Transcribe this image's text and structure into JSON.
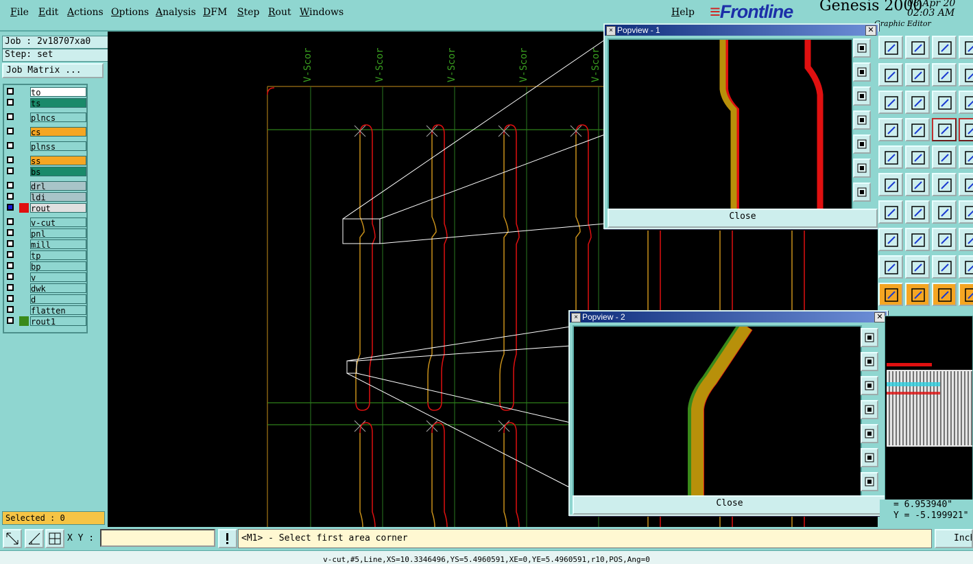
{
  "menu": {
    "items": [
      "File",
      "Edit",
      "Actions",
      "Options",
      "Analysis",
      "DFM",
      "Step",
      "Rout",
      "Windows"
    ],
    "help": "Help"
  },
  "brand": {
    "logo": "Frontline",
    "product": "Genesis 2000",
    "date": "08 Apr 20",
    "time": "02:03 AM",
    "subtitle": "Graphic Editor"
  },
  "job": {
    "job_label": "Job : 2v18707xa0",
    "step_label": "Step: set",
    "matrix_button": "Job Matrix ..."
  },
  "layers": [
    {
      "name": "to",
      "color": "#ffffff",
      "checked": false
    },
    {
      "name": "ts",
      "color": "#1a8a6a",
      "checked": false
    },
    {
      "name": "plncs",
      "color": "#8fd6d0",
      "checked": false
    },
    {
      "name": "cs",
      "color": "#f5a623",
      "checked": false
    },
    {
      "name": "plnss",
      "color": "#8fd6d0",
      "checked": false
    },
    {
      "name": "ss",
      "color": "#f5a623",
      "checked": false
    },
    {
      "name": "bs",
      "color": "#1a8a6a",
      "checked": false
    },
    {
      "name": "drl",
      "color": "#a8c4c8",
      "checked": false
    },
    {
      "name": "ldi",
      "color": "#a8c4c8",
      "checked": false
    },
    {
      "name": "rout",
      "color": "#e0e0e0",
      "checked": true,
      "swatch": "#e01010"
    },
    {
      "name": "v-cut",
      "color": "#8fd6d0",
      "checked": false
    },
    {
      "name": "pnl",
      "color": "#8fd6d0",
      "checked": false
    },
    {
      "name": "mill",
      "color": "#8fd6d0",
      "checked": false
    },
    {
      "name": "tp",
      "color": "#8fd6d0",
      "checked": false
    },
    {
      "name": "bp",
      "color": "#8fd6d0",
      "checked": false
    },
    {
      "name": "v",
      "color": "#8fd6d0",
      "checked": false
    },
    {
      "name": "dwk",
      "color": "#8fd6d0",
      "checked": false
    },
    {
      "name": "d",
      "color": "#8fd6d0",
      "checked": false
    },
    {
      "name": "flatten",
      "color": "#8fd6d0",
      "checked": false
    },
    {
      "name": "rout1",
      "color": "#8fd6d0",
      "checked": false,
      "swatch": "#3a8a1a"
    }
  ],
  "selected_label": "Selected : 0",
  "canvas": {
    "vscore_label": "V-Scor"
  },
  "popview1": {
    "title": "Popview - 1",
    "close_label": "Close"
  },
  "popview2": {
    "title": "Popview - 2",
    "close_label": "Close"
  },
  "coords": {
    "x": "= 6.953940\"",
    "y": "Y = -5.199921\""
  },
  "bottom": {
    "xy_label": "X Y :",
    "xy_value": "",
    "prompt": "<M1> - Select first area corner",
    "units": "Inch"
  },
  "status_line": "v-cut,#5,Line,XS=10.3346496,YS=5.4960591,XE=0,YE=5.4960591,r10,POS,Ang=0",
  "colors": {
    "panel": "#8fd6d0",
    "trace_orange": "#c8901a",
    "trace_red": "#e01010",
    "grid_green": "#3aa020"
  }
}
